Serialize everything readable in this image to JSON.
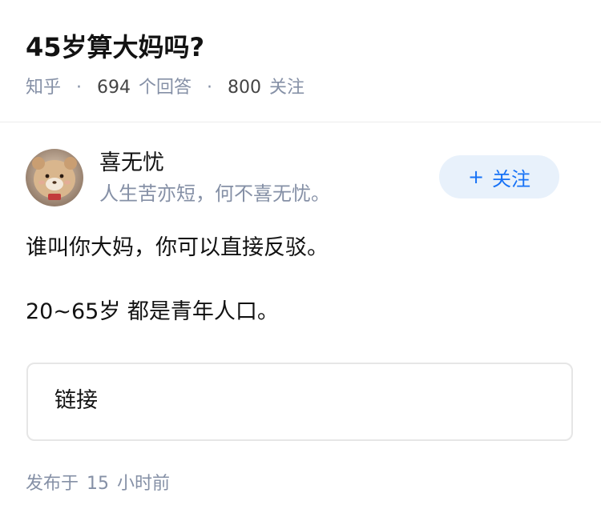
{
  "question": {
    "title": "45岁算大妈吗?",
    "source": "知乎",
    "answer_count": "694",
    "answer_label": "个回答",
    "follow_count": "800",
    "follow_label": "关注"
  },
  "author": {
    "name": "喜无忧",
    "bio": "人生苦亦短，何不喜无忧。",
    "follow_button_label": "关注",
    "follow_button_icon": "plus-icon"
  },
  "answer": {
    "paragraphs": [
      "谁叫你大妈，你可以直接反驳。",
      "20~65岁 都是青年人口。"
    ]
  },
  "link_card": {
    "label": "链接"
  },
  "footer": {
    "published_label": "发布于",
    "published_value": "15",
    "published_unit": "小时前"
  },
  "colors": {
    "accent": "#1772f6",
    "follow_button_bg": "#e8f1fb",
    "meta_gray": "#8590a6",
    "text": "#121212"
  }
}
